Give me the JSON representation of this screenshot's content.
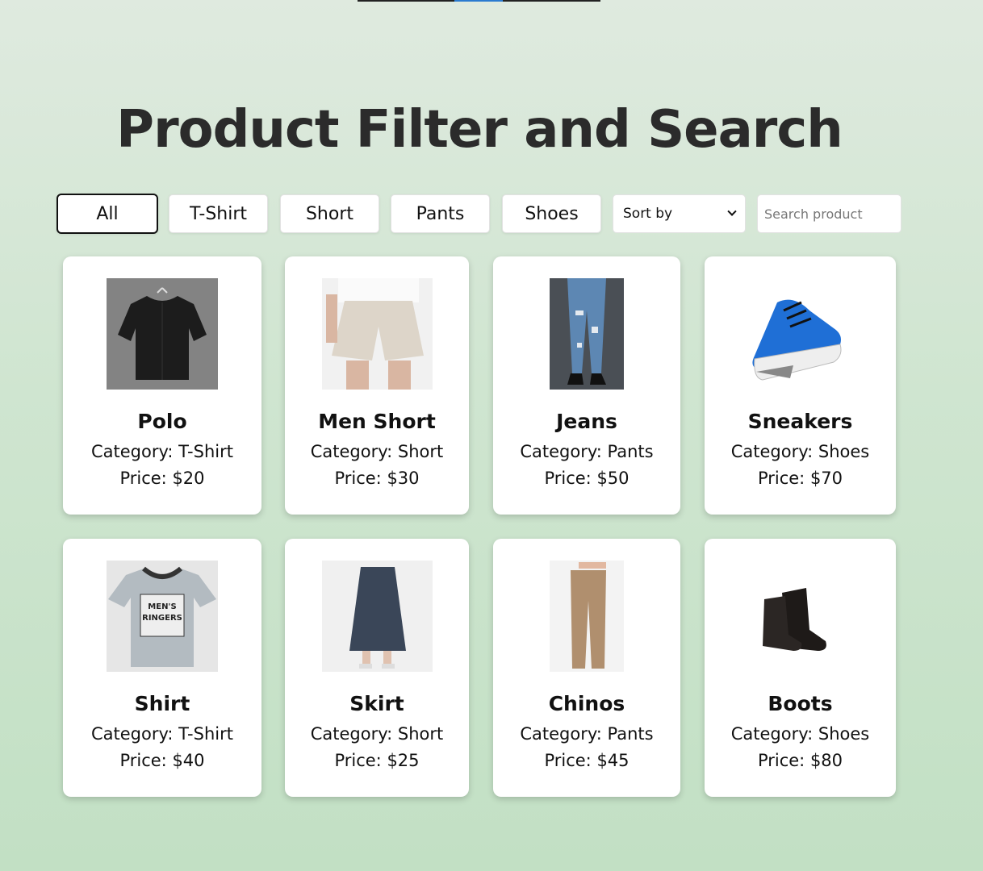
{
  "page": {
    "title": "Product Filter and Search"
  },
  "filters": [
    {
      "label": "All",
      "active": true
    },
    {
      "label": "T-Shirt",
      "active": false
    },
    {
      "label": "Short",
      "active": false
    },
    {
      "label": "Pants",
      "active": false
    },
    {
      "label": "Shoes",
      "active": false
    }
  ],
  "sort": {
    "selected": "Sort by"
  },
  "search": {
    "placeholder": "Search product",
    "value": ""
  },
  "labels": {
    "category_prefix": "Category: ",
    "price_prefix": "Price: "
  },
  "products": [
    {
      "name": "Polo",
      "category": "T-Shirt",
      "price": "$20",
      "image": "black-shirt"
    },
    {
      "name": "Men Short",
      "category": "Short",
      "price": "$30",
      "image": "beige-shorts"
    },
    {
      "name": "Jeans",
      "category": "Pants",
      "price": "$50",
      "image": "ripped-jeans"
    },
    {
      "name": "Sneakers",
      "category": "Shoes",
      "price": "$70",
      "image": "blue-sneaker"
    },
    {
      "name": "Shirt",
      "category": "T-Shirt",
      "price": "$40",
      "image": "grey-ringer-tee"
    },
    {
      "name": "Skirt",
      "category": "Short",
      "price": "$25",
      "image": "denim-skirt"
    },
    {
      "name": "Chinos",
      "category": "Pants",
      "price": "$45",
      "image": "tan-chinos"
    },
    {
      "name": "Boots",
      "category": "Shoes",
      "price": "$80",
      "image": "black-boots"
    }
  ],
  "tee_print": {
    "line1": "MEN'S",
    "line2": "RINGERS"
  },
  "colors": {
    "accent_blue": "#2b7bd0",
    "text": "#111111",
    "card_bg": "#ffffff"
  }
}
